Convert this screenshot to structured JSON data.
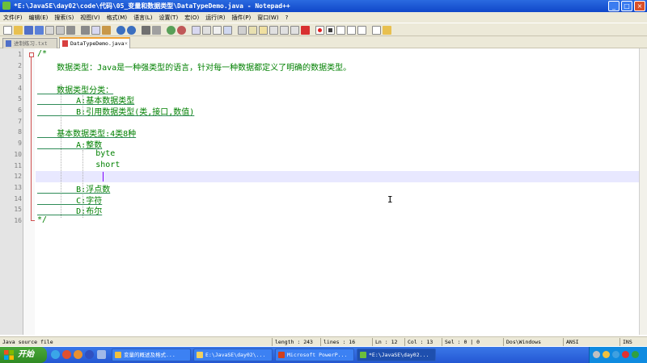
{
  "window": {
    "title": "*E:\\JavaSE\\day02\\code\\代码\\05_变量和数据类型\\DataTypeDemo.java - Notepad++"
  },
  "menu": [
    "文件(F)",
    "编辑(E)",
    "搜索(S)",
    "视图(V)",
    "格式(M)",
    "语言(L)",
    "设置(T)",
    "宏(O)",
    "运行(R)",
    "插件(P)",
    "窗口(W)",
    "?"
  ],
  "tabs": [
    {
      "label": "进制练习.txt",
      "active": false
    },
    {
      "label": "DataTypeDemo.java",
      "active": true
    }
  ],
  "editor": {
    "lines": [
      {
        "n": "1",
        "text": "/*"
      },
      {
        "n": "2",
        "text": "    数据类型：Java是一种强类型的语言，针对每一种数据都定义了明确的数据类型。"
      },
      {
        "n": "3",
        "text": ""
      },
      {
        "n": "4",
        "text": "    数据类型分类："
      },
      {
        "n": "5",
        "text": "        A:基本数据类型"
      },
      {
        "n": "6",
        "text": "        B:引用数据类型(类,接口,数值)"
      },
      {
        "n": "7",
        "text": ""
      },
      {
        "n": "8",
        "text": "    基本数据类型:4类8种"
      },
      {
        "n": "9",
        "text": "        A:整数"
      },
      {
        "n": "10",
        "text": "            byte"
      },
      {
        "n": "11",
        "text": "            short"
      },
      {
        "n": "12",
        "text": ""
      },
      {
        "n": "13",
        "text": "        B:浮点数"
      },
      {
        "n": "14",
        "text": "        C:字符"
      },
      {
        "n": "15",
        "text": "        D:布尔"
      },
      {
        "n": "16",
        "text": "*/"
      }
    ]
  },
  "status": {
    "file_type": "Java source file",
    "length": "length : 243",
    "lines": "lines : 16",
    "ln": "Ln : 12",
    "col": "Col : 13",
    "sel": "Sel : 0 | 0",
    "eol": "Dos\\Windows",
    "encoding": "ANSI",
    "mode": "INS"
  },
  "taskbar": {
    "start_label": "开始",
    "buttons": [
      {
        "label": "变量的概述及格式...",
        "active": false
      },
      {
        "label": "E:\\JavaSE\\day02\\...",
        "active": false
      },
      {
        "label": "Microsoft PowerP...",
        "active": false
      },
      {
        "label": "*E:\\JavaSE\\day02...",
        "active": true
      }
    ]
  },
  "colors": {
    "comment": "#008000",
    "caret": "#8000ff",
    "title_bar": "#1047c9"
  }
}
